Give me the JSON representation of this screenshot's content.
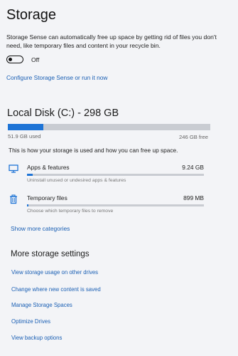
{
  "page": {
    "title": "Storage"
  },
  "storage_sense": {
    "description": "Storage Sense can automatically free up space by getting rid of files you don't need, like temporary files and content in your recycle bin.",
    "toggle_state": "Off",
    "configure_link": "Configure Storage Sense or run it now"
  },
  "disk": {
    "title": "Local Disk (C:) - 298 GB",
    "used_label": "51.9 GB used",
    "free_label": "246 GB free",
    "used_fraction": 0.174,
    "description": "This is how your storage is used and how you can free up space.",
    "categories": [
      {
        "icon": "monitor-icon",
        "name": "Apps & features",
        "size": "9.24 GB",
        "fraction": 0.031,
        "description": "Uninstall unused or undesired apps & features"
      },
      {
        "icon": "trash-icon",
        "name": "Temporary files",
        "size": "899 MB",
        "fraction": 0.01,
        "description": "Choose which temporary files to remove"
      }
    ],
    "show_more": "Show more categories"
  },
  "more_settings": {
    "title": "More storage settings",
    "links": [
      "View storage usage on other drives",
      "Change where new content is saved",
      "Manage Storage Spaces",
      "Optimize Drives",
      "View backup options"
    ]
  },
  "colors": {
    "accent": "#1e74d6",
    "link": "#1a5fb4",
    "track": "#c9ccd2",
    "background": "#f3f4f7"
  }
}
